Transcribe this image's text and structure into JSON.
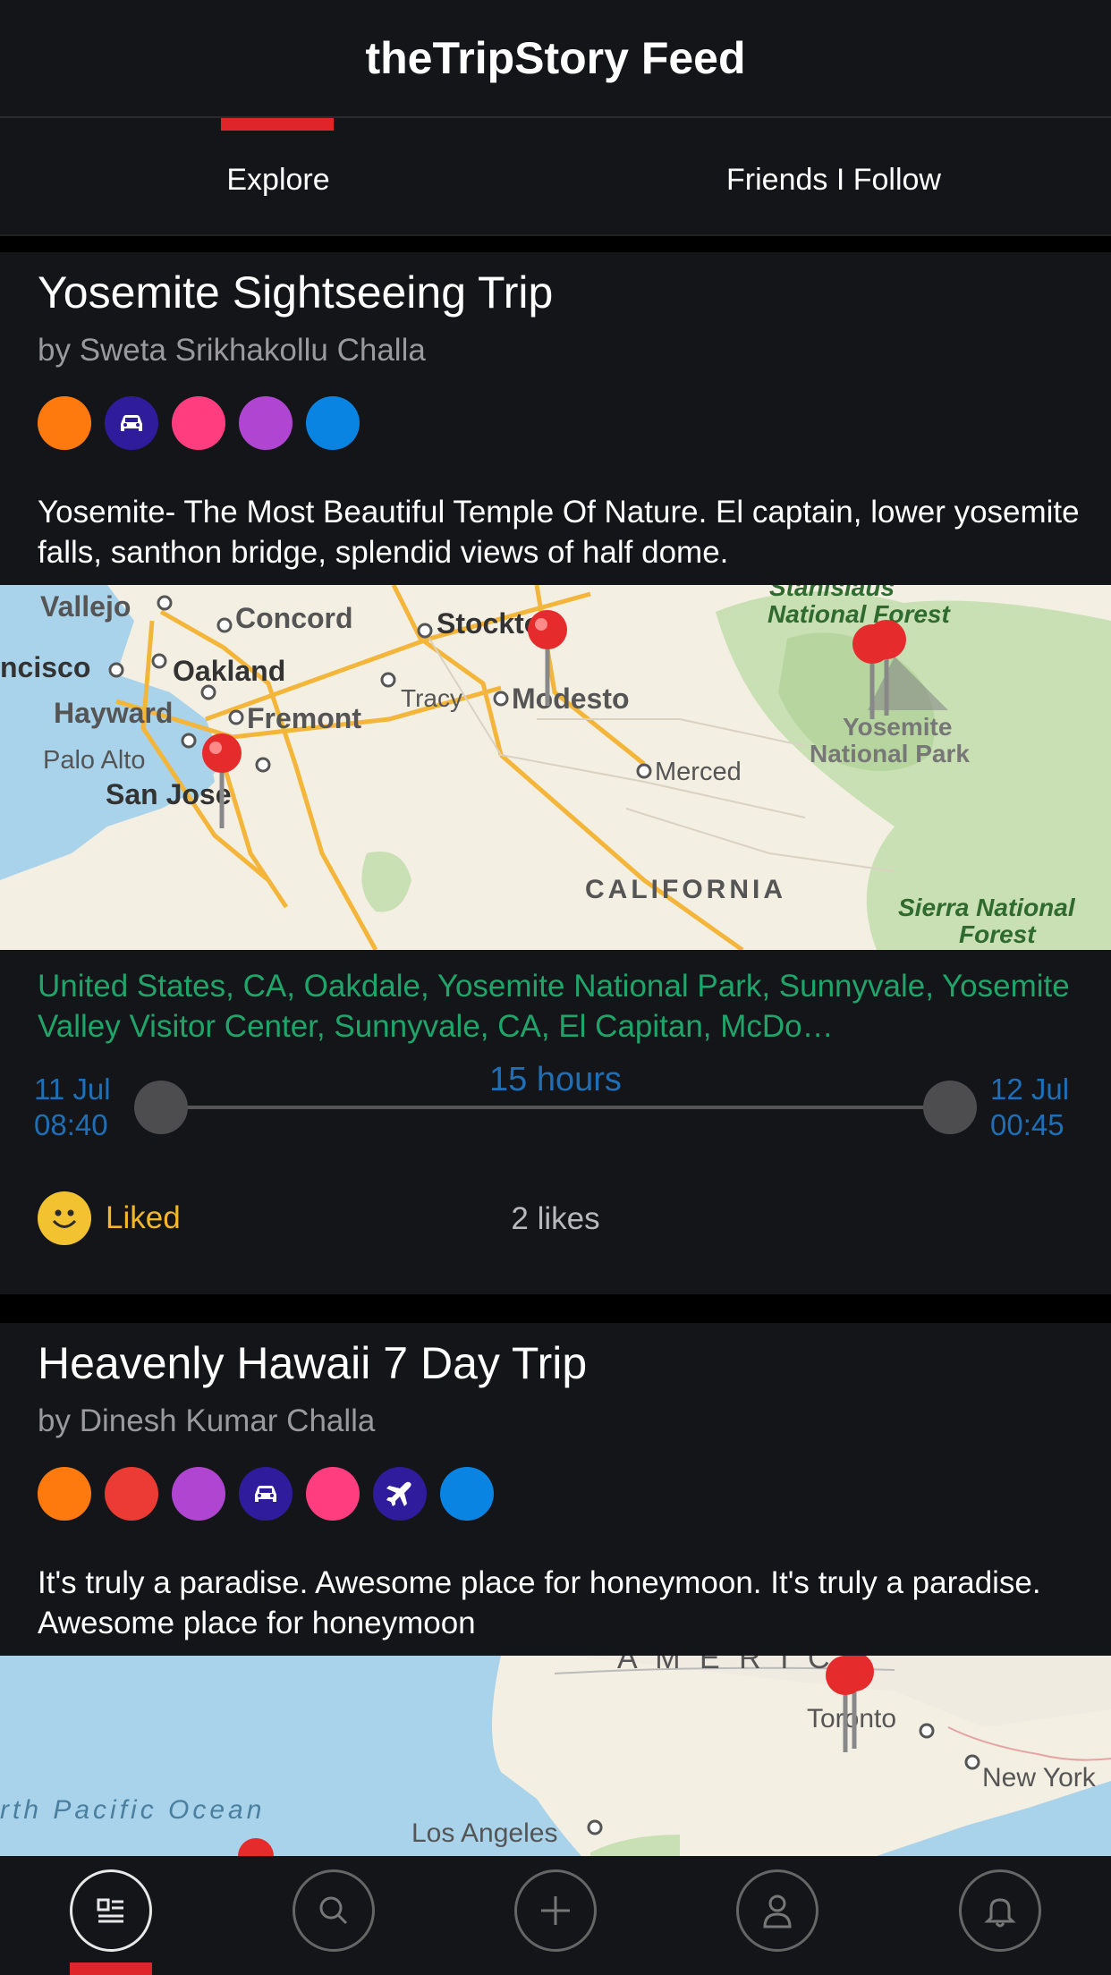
{
  "header": {
    "title": "theTripStory Feed"
  },
  "tabs": [
    {
      "label": "Explore",
      "active": true
    },
    {
      "label": "Friends I Follow",
      "active": false
    }
  ],
  "colors": {
    "accent": "#e0252a",
    "places": "#1fa56a",
    "time": "#1e6fb8",
    "liked": "#f2b72b"
  },
  "cards": [
    {
      "title": "Yosemite Sightseeing Trip",
      "author": "by Sweta Srikhakollu Challa",
      "icons": [
        {
          "name": "orange-category-icon",
          "color": "#ff7a0e",
          "glyph": ""
        },
        {
          "name": "car-icon",
          "color": "#2f1c9c",
          "glyph": "car"
        },
        {
          "name": "pink-category-icon",
          "color": "#ff3d7f",
          "glyph": ""
        },
        {
          "name": "purple-category-icon",
          "color": "#b045d2",
          "glyph": ""
        },
        {
          "name": "blue-category-icon",
          "color": "#0a84e3",
          "glyph": ""
        }
      ],
      "description": "Yosemite- The Most Beautiful Temple Of Nature.  El captain, lower yosemite falls, santhon bridge, splendid views of half dome.",
      "map_labels": {
        "vallejo": "Vallejo",
        "concord": "Concord",
        "stockton": "Stockton",
        "oakland": "Oakland",
        "francisco": "ncisco",
        "tracy": "Tracy",
        "modesto": "Modesto",
        "hayward": "Hayward",
        "fremont": "Fremont",
        "palo_alto": "Palo Alto",
        "san_jose": "San Jose",
        "merced": "Merced",
        "california": "CALIFORNIA",
        "stanislaus_1": "Stanislaus",
        "stanislaus_2": "National Forest",
        "yosemite_1": "Yosemite",
        "yosemite_2": "National Park",
        "sierra_1": "Sierra National",
        "sierra_2": "Forest"
      },
      "places": "United States, CA, Oakdale, Yosemite National Park, Sunnyvale, Yosemite Valley Visitor Center, Sunnyvale, CA, El Capitan, McDo…",
      "start_date": "11 Jul",
      "start_time": "08:40",
      "duration": "15 hours",
      "end_date": "12 Jul",
      "end_time": "00:45",
      "liked_label": "Liked",
      "likes": "2 likes"
    },
    {
      "title": "Heavenly Hawaii 7 Day Trip",
      "author": "by Dinesh Kumar Challa",
      "icons": [
        {
          "name": "orange-category-icon",
          "color": "#ff7a0e",
          "glyph": ""
        },
        {
          "name": "red-category-icon",
          "color": "#ec3a35",
          "glyph": ""
        },
        {
          "name": "purple-category-icon",
          "color": "#b045d2",
          "glyph": ""
        },
        {
          "name": "car-icon",
          "color": "#2f1c9c",
          "glyph": "car"
        },
        {
          "name": "pink-category-icon",
          "color": "#ff3d7f",
          "glyph": ""
        },
        {
          "name": "airplane-icon",
          "color": "#2f1c9c",
          "glyph": "plane"
        },
        {
          "name": "blue-category-icon",
          "color": "#0a84e3",
          "glyph": ""
        }
      ],
      "description": "It's truly a paradise. Awesome place for honeymoon.  It's truly a paradise. Awesome place for honeymoon",
      "map_labels": {
        "america": "A M E R I C A",
        "toronto": "Toronto",
        "new_york": "New York",
        "pacific": "rth  Pacific  Ocean",
        "los_angeles": "Los Angeles"
      }
    }
  ],
  "bottom_nav": [
    {
      "name": "feed",
      "active": true
    },
    {
      "name": "search",
      "active": false
    },
    {
      "name": "add",
      "active": false
    },
    {
      "name": "profile",
      "active": false
    },
    {
      "name": "notifications",
      "active": false
    }
  ]
}
